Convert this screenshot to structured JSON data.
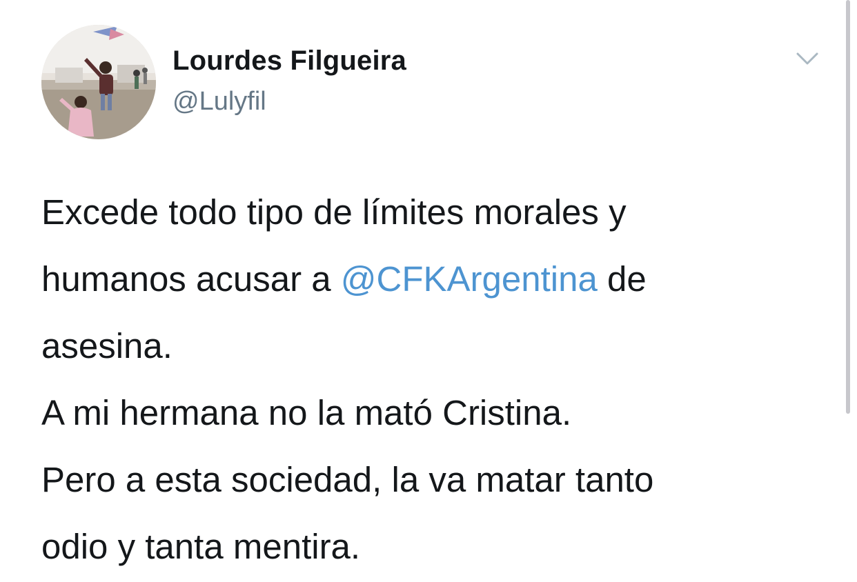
{
  "author": {
    "display_name": "Lourdes Filgueira",
    "handle": "@Lulyfil"
  },
  "tweet": {
    "line1": "Excede todo tipo de límites morales y",
    "line2_before": "humanos acusar a ",
    "mention": "@CFKArgentina",
    "line2_after": " de",
    "line3": "asesina.",
    "line4": "A mi hermana no la mató Cristina.",
    "line5": "Pero a esta sociedad, la va matar tanto",
    "line6": "odio y tanta mentira."
  },
  "icons": {
    "menu": "chevron-down-icon",
    "avatar": "profile-photo"
  },
  "colors": {
    "mention": "#4d94d1",
    "handle": "#657786",
    "text": "#14171a"
  }
}
